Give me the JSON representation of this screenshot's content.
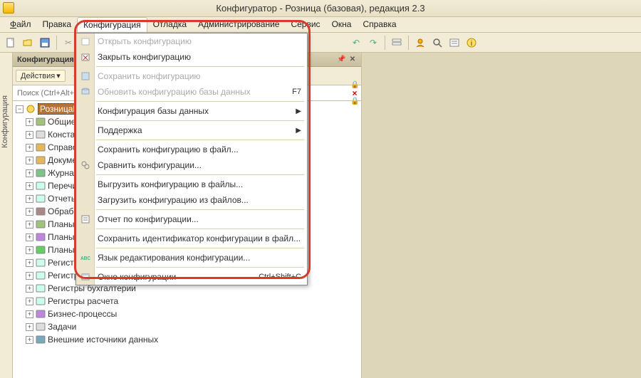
{
  "title": "Конфигуратор - Розница (базовая), редакция 2.3",
  "menubar": {
    "file": "Файл",
    "edit": "Правка",
    "config": "Конфигурация",
    "debug": "Отладка",
    "admin": "Администрирование",
    "service": "Сервис",
    "windows": "Окна",
    "help": "Справка"
  },
  "panel": {
    "title": "Конфигурация",
    "actions": "Действия",
    "search_placeholder": "Поиск (Ctrl+Alt+M)",
    "side_tab": "Конфигурация"
  },
  "tree": {
    "root": "РозницаБазовая",
    "items": [
      "Общие",
      "Константы",
      "Справочники",
      "Документы",
      "Журналы документов",
      "Перечисления",
      "Отчеты",
      "Обработки",
      "Планы видов характеристик",
      "Планы счетов",
      "Планы видов расчета",
      "Регистры сведений",
      "Регистры накопления",
      "Регистры бухгалтерии",
      "Регистры расчета",
      "Бизнес-процессы",
      "Задачи",
      "Внешние источники данных"
    ]
  },
  "dropdown": {
    "open": "Открыть конфигурацию",
    "close": "Закрыть конфигурацию",
    "save": "Сохранить конфигурацию",
    "update_db": "Обновить конфигурацию базы данных",
    "update_db_key": "F7",
    "db_config": "Конфигурация базы данных",
    "support": "Поддержка",
    "save_to_file": "Сохранить конфигурацию в файл...",
    "compare": "Сравнить конфигурации...",
    "export_files": "Выгрузить конфигурацию в файлы...",
    "import_files": "Загрузить конфигурацию из файлов...",
    "report": "Отчет по конфигурации...",
    "save_id": "Сохранить идентификатор конфигурации в файл...",
    "edit_lang": "Язык редактирования конфигурации...",
    "window": "Окно конфигурации",
    "window_key": "Ctrl+Shift+C"
  }
}
